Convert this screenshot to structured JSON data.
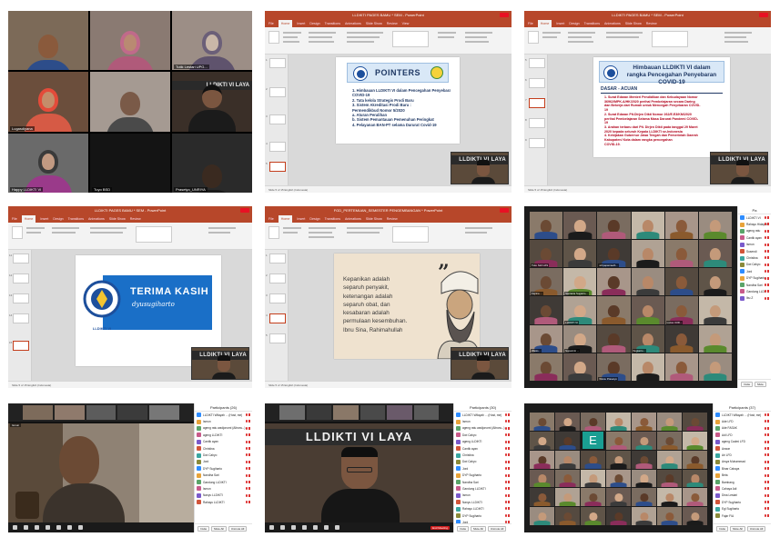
{
  "tile1": {
    "participants": [
      {
        "name": ""
      },
      {
        "name": ""
      },
      {
        "name": "Tutik Lestari UPG..."
      },
      {
        "name": "Lugasdiyana"
      },
      {
        "name": ""
      },
      {
        "name": ""
      },
      {
        "name": "Happy LLDIKTI VI"
      },
      {
        "name": "Tuyo BSD"
      },
      {
        "name": "Prasetyo_UNRIYA"
      }
    ],
    "banner": "LLDIKTI VI LAYA"
  },
  "ppt": {
    "title_lldikti": "LLDIKTI PAGES BAMU * SEM - PowerPoint",
    "title_fgd": "FGD_PERTEMUAN_SEMESTER PENGEMBANGAN * PowerPoint",
    "tabs": [
      "File",
      "Home",
      "Insert",
      "Design",
      "Transitions",
      "Animations",
      "Slide Show",
      "Review",
      "View",
      "Help",
      "Macro File",
      "Tell me what you want to do"
    ],
    "status": "Slide 5 of 15 English (Indonesia)",
    "pip_banner": "LLDIKTI VI LAYA"
  },
  "slide_pointers": {
    "title": "POINTERS",
    "items": [
      "1.  Himbauan LLDIKTI VI dalam Pencegahan Penyebaran",
      "     COVID-19",
      "2.  Tata kelola Strategis Prodi Baru",
      "3.  Sistem Akreditasi Prodi Baru :",
      "     Permendikbud Nomor 5/2020",
      "     a.  Aturan Peralihan",
      "     b.  Sistem Pemantauan Pemenuhan Peringkat",
      "4.  Pelayanan BAN-PT selama Darurat Covid-19"
    ]
  },
  "slide_himbauan": {
    "title": "Himbauan LLDIKTI VI dalam rangka Pencegahan Penyebaran COVID-19",
    "subtitle": "DASAR - ACUAN",
    "items": [
      "1.  Surat Edaran Menteri Pendidikan dan Kebudayaan Nomor",
      "     36962/MPK.A/HK/2020 perihal Pembelajaran secara Daring",
      "     dan Bekerja dari Rumah untuk Mencegah Penyebaran COVID-",
      "     19",
      "2.  Surat Edaran Plt.Dirjen Dikti Nomor 262/E.E3/KM/2020",
      "     perihal Pembelajaran Selama Masa Darurat Pandemi COVID-",
      "     19",
      "3.  Arahan terbaru dari Plt. Dirjen Dikti pada tanggal 29 Maret",
      "     2020 kepada seluruh Kepala LLDIKTI se-Indonesia",
      "4.  Kebijakan Gubernur Jawa Tengah dan Pemerintah Daerah",
      "     Kabupaten/ Kota dalam rangka pencegahan",
      "     COVID-19."
    ]
  },
  "slide_terimakasih": {
    "title": "TERIMA KASIH",
    "signature": "dyusugiharto",
    "logo_text": "LLDIKTI VI"
  },
  "slide_quote": {
    "lines": [
      "Kepanikan adalah",
      "separuh penyakit,",
      "ketenangan adalah",
      "separuh obat, dan",
      "kesabaran adalah",
      "permulaan kesembuhan."
    ],
    "source": "Ibnu Sina, Rahimahullah",
    "mark": "”"
  },
  "gallery6": {
    "cells": [
      {
        "name": ""
      },
      {
        "name": ""
      },
      {
        "name": ""
      },
      {
        "name": ""
      },
      {
        "name": ""
      },
      {
        "name": ""
      },
      {
        "name": "Tuko Sidi UAS"
      },
      {
        "name": ""
      },
      {
        "name": "wiriyapamaeth..."
      },
      {
        "name": ""
      },
      {
        "name": ""
      },
      {
        "name": ""
      },
      {
        "name": "Fajrina ..."
      },
      {
        "name": "Sanitaria Sugiarto..."
      },
      {
        "name": ""
      },
      {
        "name": ""
      },
      {
        "name": ""
      },
      {
        "name": ""
      },
      {
        "name": ""
      },
      {
        "name": "LLDIKTI VI"
      },
      {
        "name": ""
      },
      {
        "name": ""
      },
      {
        "name": "Lucas UUD..."
      },
      {
        "name": ""
      },
      {
        "name": "Wasis..."
      },
      {
        "name": "Suparmin ..."
      },
      {
        "name": ""
      },
      {
        "name": "Sugianto..."
      },
      {
        "name": ""
      },
      {
        "name": ""
      },
      {
        "name": ""
      },
      {
        "name": ""
      },
      {
        "name": "Wisnu Prasetyo"
      },
      {
        "name": ""
      },
      {
        "name": ""
      },
      {
        "name": ""
      }
    ],
    "panel_title": "Pa",
    "panel_items": [
      "LLDIKTI VI",
      "Rahayu Hidayat",
      "ageng ratu",
      "Cantik ayan",
      "Ismun",
      "Susendi",
      "Christina",
      "Dwi Cahyo",
      "Jord",
      "DYP Sugiharto",
      "Nandha Sari",
      "Gandung LLDI",
      "Ibu Z"
    ],
    "panel_buttons": [
      "Invite",
      "Mute"
    ]
  },
  "speaker7": {
    "panel_title": "Participants (26)",
    "items": [
      "LLDIKTI Wilayah ... (Host, me)",
      "Ismun",
      "ageng ratu wadjonomi (Altnow...)",
      "ageng LLDIKTI",
      "Cantik ayan",
      "Christina",
      "Dwi Cahyo",
      "Jord",
      "DYP Sugiharto",
      "Nandha Sari",
      "Gandung LLDIKTI",
      "Ismun",
      "Nanyu LLDIKTI",
      "Rahayu LLDIKTI"
    ],
    "buttons": [
      "Invite",
      "Mute All",
      "Unmute All",
      "More"
    ],
    "label": "Ismun"
  },
  "speaker8": {
    "panel_title": "Participants (30)",
    "banner": "LLDIKTI VI LAYA",
    "items": [
      "LLDIKTI Wilayah ... (Host, me)",
      "Ismun",
      "ageng ratu wadjonomi (Altnow...)",
      "Dwi Cahyo",
      "ageng LLDIKTI",
      "Cantik ayan",
      "Christina",
      "Dwi Cahyo",
      "Jord",
      "DYP Sugiharto",
      "Nandha Sari",
      "Gandung LLDIKTI",
      "Ismun",
      "Nanyu LLDIKTI",
      "Rahayu LLDIKTI",
      "DYP Sugiharto",
      "Jord"
    ],
    "buttons": [
      "Invite",
      "Mute All",
      "Unmute All",
      "More"
    ],
    "end": "End Meeting"
  },
  "gallery9": {
    "panel_title": "Participants (37)",
    "letter": "E",
    "items": [
      "LLDIKTI Wilayah ... (Host, me)",
      "Ade LFD",
      "Ade FASAK",
      "Adi LFD",
      "ageng Cadmi LFD",
      "Anwar",
      "Ari LFD",
      "Arsya Muhammad",
      "Binar Cahaya",
      "Beta",
      "Bambang",
      "Cahaya Adi",
      "Dina Lestari",
      "DYP Sugiharto",
      "Egi Sugiharto",
      "Fajar FIA"
    ],
    "buttons": [
      "Invite",
      "Mute All",
      "Unmute All",
      "More"
    ]
  }
}
